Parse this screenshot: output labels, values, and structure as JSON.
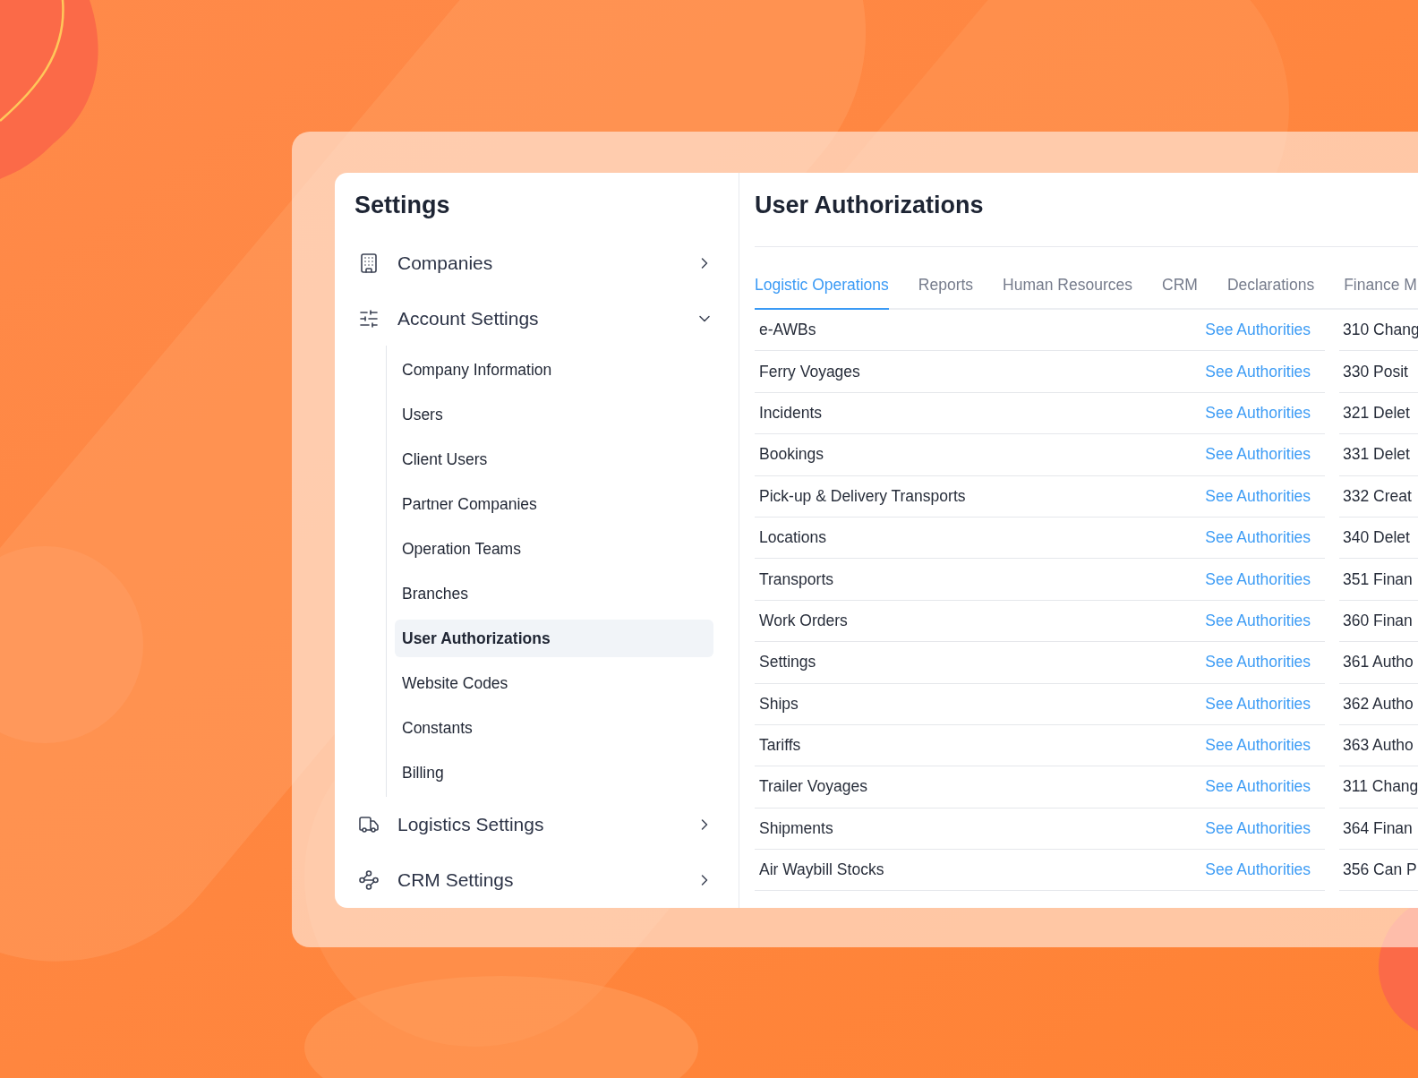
{
  "sidebar": {
    "title": "Settings",
    "items": [
      {
        "label": "Companies",
        "expanded": false
      },
      {
        "label": "Account Settings",
        "expanded": true,
        "children": [
          {
            "label": "Company Information",
            "selected": false
          },
          {
            "label": "Users",
            "selected": false
          },
          {
            "label": "Client Users",
            "selected": false
          },
          {
            "label": "Partner Companies",
            "selected": false
          },
          {
            "label": "Operation Teams",
            "selected": false
          },
          {
            "label": "Branches",
            "selected": false
          },
          {
            "label": "User Authorizations",
            "selected": true
          },
          {
            "label": "Website Codes",
            "selected": false
          },
          {
            "label": "Constants",
            "selected": false
          },
          {
            "label": "Billing",
            "selected": false
          }
        ]
      },
      {
        "label": "Logistics Settings",
        "expanded": false
      },
      {
        "label": "CRM Settings",
        "expanded": false
      }
    ]
  },
  "main": {
    "title": "User Authorizations",
    "tabs": [
      {
        "label": "Logistic Operations",
        "selected": true
      },
      {
        "label": "Reports",
        "selected": false
      },
      {
        "label": "Human Resources",
        "selected": false
      },
      {
        "label": "CRM",
        "selected": false
      },
      {
        "label": "Declarations",
        "selected": false
      },
      {
        "label": "Finance M",
        "selected": false
      }
    ],
    "rows": [
      {
        "name": "e-AWBs",
        "link": "See Authorities",
        "column_2": "310 Chang"
      },
      {
        "name": "Ferry Voyages",
        "link": "See Authorities",
        "column_2": "330 Posit"
      },
      {
        "name": "Incidents",
        "link": "See Authorities",
        "column_2": "321 Delet"
      },
      {
        "name": "Bookings",
        "link": "See Authorities",
        "column_2": "331 Delet"
      },
      {
        "name": "Pick-up & Delivery Transports",
        "link": "See Authorities",
        "column_2": "332 Creat"
      },
      {
        "name": "Locations",
        "link": "See Authorities",
        "column_2": "340 Delet"
      },
      {
        "name": "Transports",
        "link": "See Authorities",
        "column_2": "351 Finan"
      },
      {
        "name": "Work Orders",
        "link": "See Authorities",
        "column_2": "360 Finan"
      },
      {
        "name": "Settings",
        "link": "See Authorities",
        "column_2": "361 Autho"
      },
      {
        "name": "Ships",
        "link": "See Authorities",
        "column_2": "362 Autho"
      },
      {
        "name": "Tariffs",
        "link": "See Authorities",
        "column_2": "363 Autho"
      },
      {
        "name": "Trailer Voyages",
        "link": "See Authorities",
        "column_2": "311 Chang"
      },
      {
        "name": "Shipments",
        "link": "See Authorities",
        "column_2": "364 Finan"
      },
      {
        "name": "Air Waybill Stocks",
        "link": "See Authorities",
        "column_2": "356 Can P"
      }
    ]
  }
}
